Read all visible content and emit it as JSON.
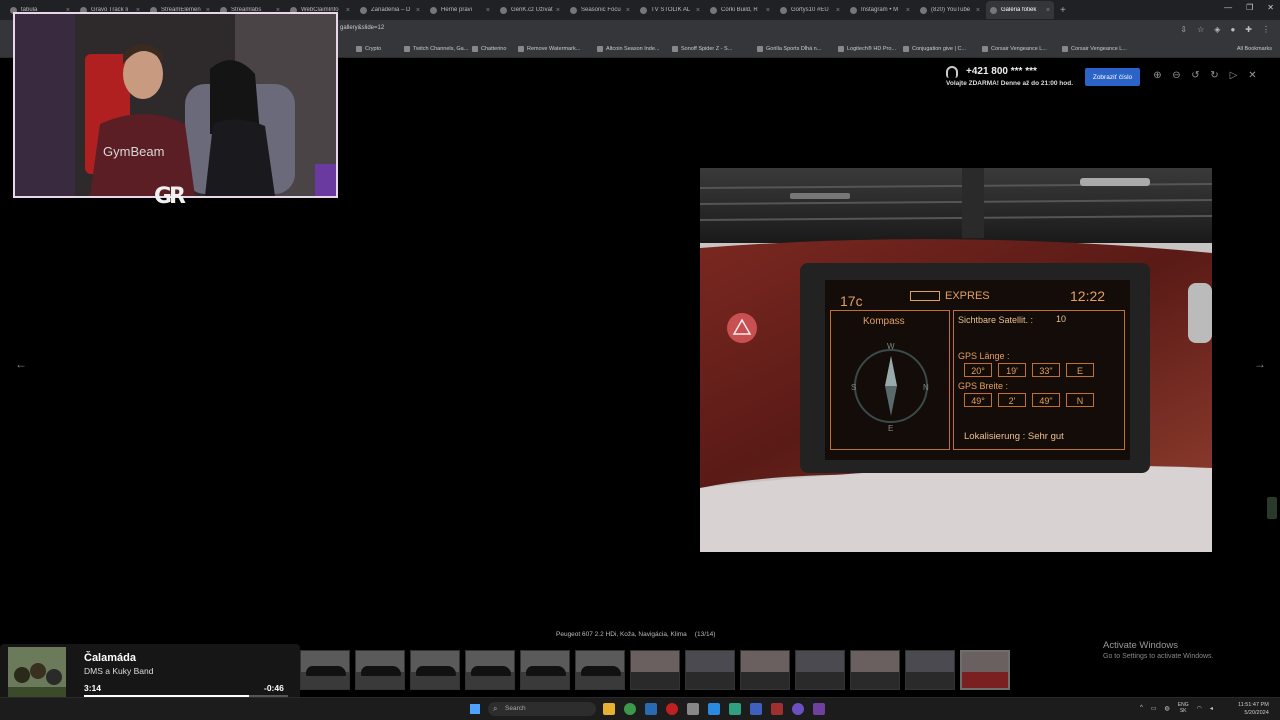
{
  "browser": {
    "tabs": [
      {
        "label": "tabula"
      },
      {
        "label": "Gravo Track li"
      },
      {
        "label": "StreamElemen"
      },
      {
        "label": "Streamlabs"
      },
      {
        "label": "WebClaimInfo"
      },
      {
        "label": "Zariadenia – D"
      },
      {
        "label": "Herné pravi"
      },
      {
        "label": "GenK.cz Užívat"
      },
      {
        "label": "Seasonic Focu"
      },
      {
        "label": "TV STOLÍK AL"
      },
      {
        "label": "Corki Build, R"
      },
      {
        "label": "Gortys10 #EU"
      },
      {
        "label": "Instagram • M"
      },
      {
        "label": "(820) YouTube"
      },
      {
        "label": "Galéria fotiek"
      }
    ],
    "url": "gallery&slide=12",
    "bookmarks": [
      "Crypto",
      "Twitch Channels, Ga...",
      "Chatterino",
      "Remove Watermark...",
      "Altcoin Season Inde...",
      "Sonoff Spider Z - S...",
      "Gorilla Sports Dĺhá n...",
      "Logitech® HD Pro...",
      "Conjugation give | C...",
      "Corsair Vengeance L...",
      "Corsair Vengeance L..."
    ],
    "all_bookmarks": "All Bookmarks"
  },
  "gallery": {
    "phone_number": "+421 800 *** ***",
    "phone_subtitle": "Volajte ZDARMA! Denne až do 21:00 hod.",
    "show_number_button": "Zobraziť číslo",
    "caption": "Peugeot 607 2.2 HDi, Koža, Navigácia, Klima",
    "counter": "(13/14)",
    "nav_screen": {
      "temp": "17c",
      "mode": "EXPRES",
      "time": "12:22",
      "compass_title": "Kompass",
      "satellites_label": "Sichtbare Satellit. :",
      "satellites_value": "10",
      "gps_lange_label": "GPS Länge :",
      "gps_lange": [
        "20°",
        "19'",
        "33\"",
        "E"
      ],
      "gps_breite_label": "GPS Breite :",
      "gps_breite": [
        "49°",
        "2'",
        "49\"",
        "N"
      ],
      "localisation": "Lokalisierung : Sehr gut"
    },
    "thumbnail_count": 13,
    "selected_thumbnail": 13
  },
  "overlay": {
    "cam_logo": "GR",
    "shirt_text": "GymBeam"
  },
  "music": {
    "song": "Čalamáda",
    "artist": "DMS a Kuky Band",
    "elapsed": "3:14",
    "remaining": "-0:46",
    "progress": 0.81
  },
  "windows": {
    "activate_title": "Activate Windows",
    "activate_sub": "Go to Settings to activate Windows."
  },
  "taskbar": {
    "search_placeholder": "Search",
    "lang_line1": "ENG",
    "lang_line2": "SK",
    "time": "11:51:47 PM",
    "date": "5/20/2024"
  },
  "colors": {
    "accent_button": "#2b63c6",
    "nav_screen_text": "#e0a060"
  }
}
